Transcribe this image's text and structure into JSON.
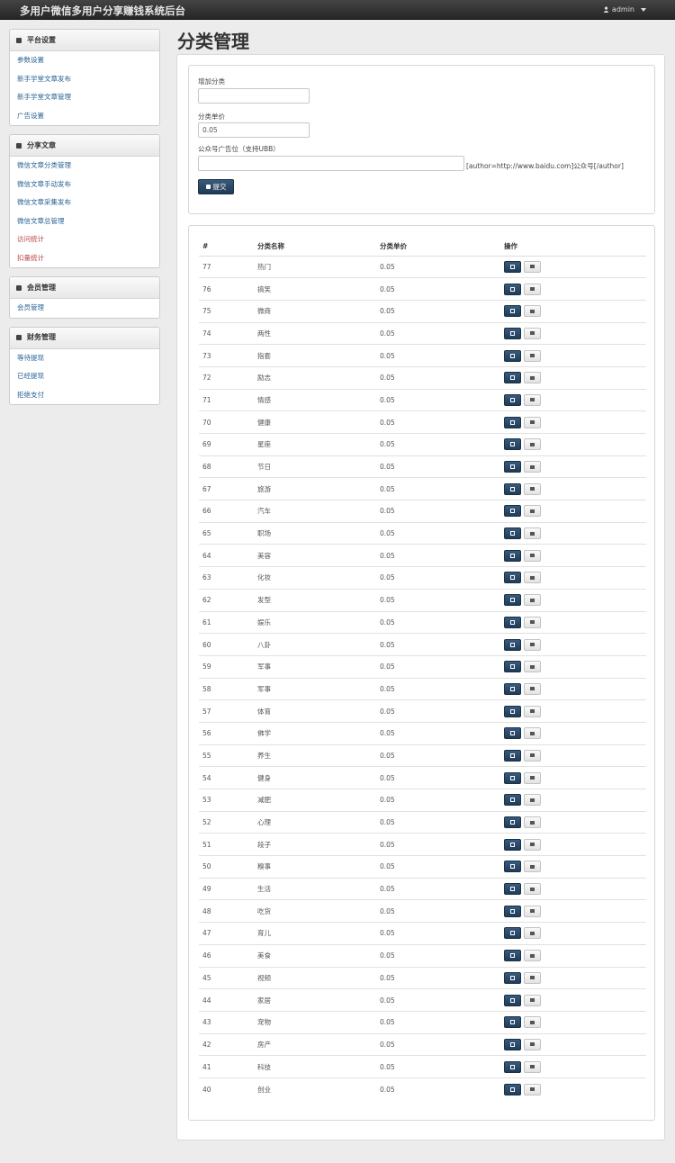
{
  "app": {
    "title": "多用户微信多用户分享赚钱系统后台",
    "user": "admin"
  },
  "sidebar": {
    "groups": [
      {
        "title": "平台设置",
        "items": [
          {
            "label": "参数设置",
            "color": "#2a6496"
          },
          {
            "label": "新手学堂文章发布",
            "color": "#2a6496"
          },
          {
            "label": "新手学堂文章管理",
            "color": "#2a6496"
          },
          {
            "label": "广告设置",
            "color": "#2a6496"
          }
        ]
      },
      {
        "title": "分享文章",
        "items": [
          {
            "label": "微信文章分类管理",
            "color": "#2a6496"
          },
          {
            "label": "微信文章手动发布",
            "color": "#2a6496"
          },
          {
            "label": "微信文章采集发布",
            "color": "#2a6496"
          },
          {
            "label": "微信文章总管理",
            "color": "#2a6496"
          },
          {
            "label": "访问统计",
            "color": "#b94a48"
          },
          {
            "label": "扣量统计",
            "color": "#b94a48"
          }
        ]
      },
      {
        "title": "会员管理",
        "items": [
          {
            "label": "会员管理",
            "color": "#2a6496"
          }
        ]
      },
      {
        "title": "财务管理",
        "items": [
          {
            "label": "等待提现",
            "color": "#2a6496"
          },
          {
            "label": "已经提现",
            "color": "#2a6496"
          },
          {
            "label": "拒绝支付",
            "color": "#2a6496"
          }
        ]
      }
    ]
  },
  "page": {
    "title": "分类管理"
  },
  "form": {
    "add_label": "增加分类",
    "add_value": "",
    "price_label": "分类单价",
    "price_value": "0.05",
    "ad_label": "公众号广告位（支持UBB）",
    "ad_value": "",
    "ad_hint": "[author=http://www.baidu.com]公众号[/author]",
    "submit_label": "提交"
  },
  "table": {
    "columns": [
      "#",
      "分类名称",
      "分类单价",
      "操作"
    ],
    "rows": [
      [
        "77",
        "热门",
        "0.05"
      ],
      [
        "76",
        "搞笑",
        "0.05"
      ],
      [
        "75",
        "微商",
        "0.05"
      ],
      [
        "74",
        "两性",
        "0.05"
      ],
      [
        "73",
        "指套",
        "0.05"
      ],
      [
        "72",
        "励志",
        "0.05"
      ],
      [
        "71",
        "情感",
        "0.05"
      ],
      [
        "70",
        "健康",
        "0.05"
      ],
      [
        "69",
        "星座",
        "0.05"
      ],
      [
        "68",
        "节日",
        "0.05"
      ],
      [
        "67",
        "旅游",
        "0.05"
      ],
      [
        "66",
        "汽车",
        "0.05"
      ],
      [
        "65",
        "职场",
        "0.05"
      ],
      [
        "64",
        "美容",
        "0.05"
      ],
      [
        "63",
        "化妆",
        "0.05"
      ],
      [
        "62",
        "发型",
        "0.05"
      ],
      [
        "61",
        "娱乐",
        "0.05"
      ],
      [
        "60",
        "八卦",
        "0.05"
      ],
      [
        "59",
        "军事",
        "0.05"
      ],
      [
        "58",
        "军事",
        "0.05"
      ],
      [
        "57",
        "体育",
        "0.05"
      ],
      [
        "56",
        "佛学",
        "0.05"
      ],
      [
        "55",
        "养生",
        "0.05"
      ],
      [
        "54",
        "健身",
        "0.05"
      ],
      [
        "53",
        "减肥",
        "0.05"
      ],
      [
        "52",
        "心理",
        "0.05"
      ],
      [
        "51",
        "段子",
        "0.05"
      ],
      [
        "50",
        "糗事",
        "0.05"
      ],
      [
        "49",
        "生活",
        "0.05"
      ],
      [
        "48",
        "吃货",
        "0.05"
      ],
      [
        "47",
        "育儿",
        "0.05"
      ],
      [
        "46",
        "美食",
        "0.05"
      ],
      [
        "45",
        "视频",
        "0.05"
      ],
      [
        "44",
        "家居",
        "0.05"
      ],
      [
        "43",
        "宠物",
        "0.05"
      ],
      [
        "42",
        "房产",
        "0.05"
      ],
      [
        "41",
        "科技",
        "0.05"
      ],
      [
        "40",
        "创业",
        "0.05"
      ]
    ]
  }
}
